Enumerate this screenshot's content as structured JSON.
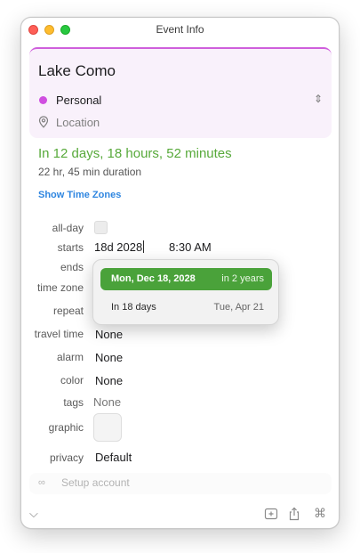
{
  "window": {
    "title": "Event Info"
  },
  "event": {
    "title": "Lake Como",
    "calendar": {
      "name": "Personal",
      "color": "#d04fe0"
    },
    "location_placeholder": "Location"
  },
  "summary": {
    "countdown": "In 12 days, 18 hours, 52 minutes",
    "duration": "22 hr, 45 min duration",
    "show_time_zones": "Show Time Zones"
  },
  "fields": {
    "allday_label": "all-day",
    "starts_label": "starts",
    "starts_date_input": "18d 2028",
    "starts_time": "8:30 AM",
    "ends_label": "ends",
    "timezone_label": "time zone",
    "repeat_label": "repeat",
    "travel_label": "travel time",
    "travel_value": "None",
    "alarm_label": "alarm",
    "alarm_value": "None",
    "color_label": "color",
    "color_value": "None",
    "tags_label": "tags",
    "tags_value": "None",
    "graphic_label": "graphic",
    "privacy_label": "privacy",
    "privacy_value": "Default"
  },
  "date_suggestions": [
    {
      "main": "Mon, Dec 18, 2028",
      "side": "in 2 years",
      "selected": true
    },
    {
      "main": "In 18 days",
      "side": "Tue, Apr 21",
      "selected": false
    }
  ],
  "setup": {
    "label": "Setup account"
  },
  "colors": {
    "accent_green": "#57a93a",
    "link_blue": "#2f86e0",
    "calendar_purple": "#d04fe0"
  }
}
